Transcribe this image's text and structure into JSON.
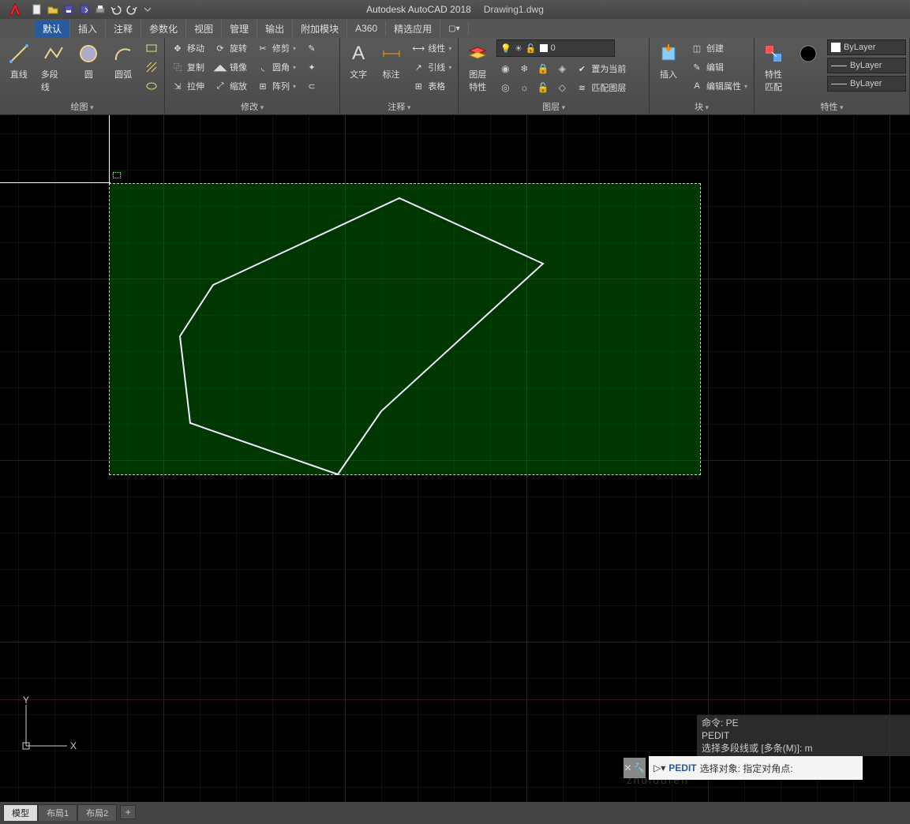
{
  "app": {
    "name": "Autodesk AutoCAD 2018",
    "file": "Drawing1.dwg"
  },
  "tabs": [
    "默认",
    "插入",
    "注释",
    "参数化",
    "视图",
    "管理",
    "输出",
    "附加模块",
    "A360",
    "精选应用"
  ],
  "active_tab": 0,
  "panels": {
    "draw": {
      "title": "绘图",
      "line": "直线",
      "polyline": "多段线",
      "circle": "圆",
      "arc": "圆弧"
    },
    "modify": {
      "title": "修改",
      "move": "移动",
      "rotate": "旋转",
      "trim": "修剪",
      "copy": "复制",
      "mirror": "镜像",
      "fillet": "圆角",
      "stretch": "拉伸",
      "scale": "缩放",
      "array": "阵列"
    },
    "annot": {
      "title": "注释",
      "text": "文字",
      "dim": "标注",
      "linetype": "线性",
      "leader": "引线",
      "table": "表格"
    },
    "layer": {
      "title": "图层",
      "props": "图层\n特性",
      "current": "0",
      "set_current": "置为当前",
      "match": "匹配图层"
    },
    "block": {
      "title": "块",
      "insert": "插入",
      "create": "创建",
      "edit": "编辑",
      "editattr": "编辑属性"
    },
    "props": {
      "title": "特性",
      "match": "特性\n匹配",
      "bylayer": "ByLayer"
    }
  },
  "layout_tabs": [
    "模型",
    "布局1",
    "布局2"
  ],
  "active_layout": 0,
  "command": {
    "history1": "命令: PE",
    "history2": "PEDIT",
    "history3": "选择多段线或 [多条(M)]: m",
    "name": "PEDIT",
    "prompt": "选择对象: 指定对角点:"
  },
  "ucs": {
    "x": "X",
    "y": "Y"
  },
  "watermark": "zhulouren"
}
